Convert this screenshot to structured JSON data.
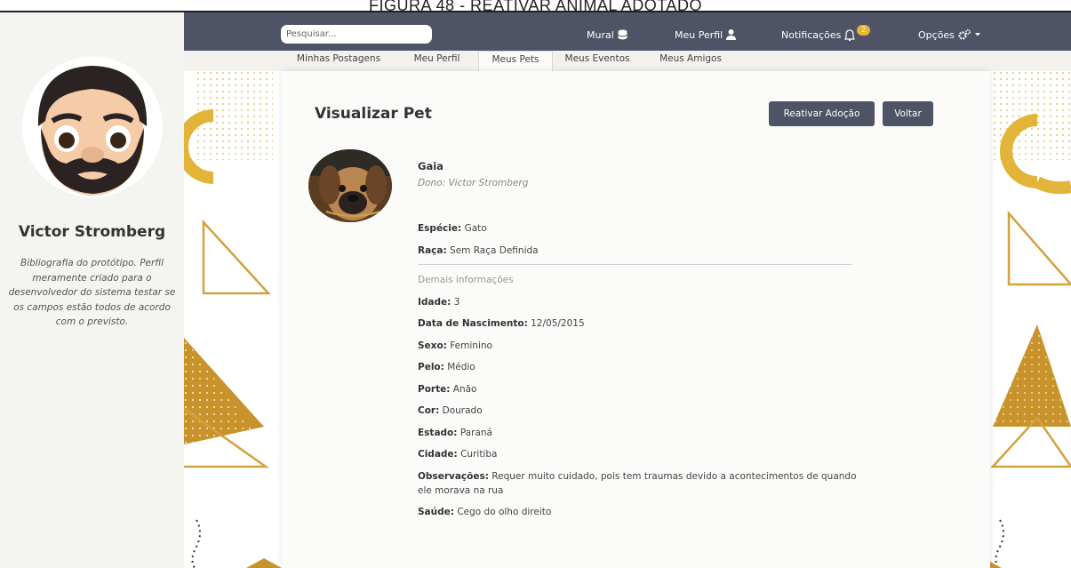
{
  "caption": "FIGURA 48 - REATIVAR ANIMAL ADOTADO",
  "nav": {
    "search_placeholder": "Pesquisar...",
    "mural": "Mural",
    "meu_perfil": "Meu Perfil",
    "notificacoes": "Notificações",
    "notification_count": "2",
    "opcoes": "Opções",
    "icons": [
      "database-icon",
      "user-icon",
      "bell-icon",
      "gears-icon",
      "caret-down-icon"
    ]
  },
  "tabs": [
    {
      "label": "Minhas Postagens",
      "active": false
    },
    {
      "label": "Meu Perfil",
      "active": false
    },
    {
      "label": "Meus Pets",
      "active": true
    },
    {
      "label": "Meus Eventos",
      "active": false
    },
    {
      "label": "Meus Amigos",
      "active": false
    }
  ],
  "profile": {
    "name": "Victor Stromberg",
    "bio": "Bibliografia do protótipo. Perfil meramente criado para o desenvolvedor do sistema testar se os campos estão todos de acordo com o previsto."
  },
  "card": {
    "title": "Visualizar Pet",
    "reactivate_button": "Reativar Adoção",
    "back_button": "Voltar"
  },
  "pet": {
    "name": "Gaia",
    "owner": "Dono: Victor Stromberg",
    "especie_label": "Espécie:",
    "especie": "Gato",
    "raca_label": "Raça:",
    "raca": "Sem Raça Definida",
    "section_label": "Demais informações",
    "idade_label": "Idade:",
    "idade": "3",
    "nascimento_label": "Data de Nascimento:",
    "nascimento": "12/05/2015",
    "sexo_label": "Sexo:",
    "sexo": "Feminino",
    "pelo_label": "Pelo:",
    "pelo": "Médio",
    "porte_label": "Porte:",
    "porte": "Anão",
    "cor_label": "Cor:",
    "cor": "Dourado",
    "estado_label": "Estado:",
    "estado": "Paraná",
    "cidade_label": "Cidade:",
    "cidade": "Curitiba",
    "obs_label": "Observações:",
    "obs": "Requer muito cuidado, pois tem traumas devido a acontecimentos de quando ele morava na rua",
    "saude_label": "Saúde:",
    "saude": "Cego do olho direito"
  },
  "colors": {
    "nav_bg": "#4e5365",
    "accent_gold": "#e8b432",
    "deco_gold": "#c9932b"
  }
}
